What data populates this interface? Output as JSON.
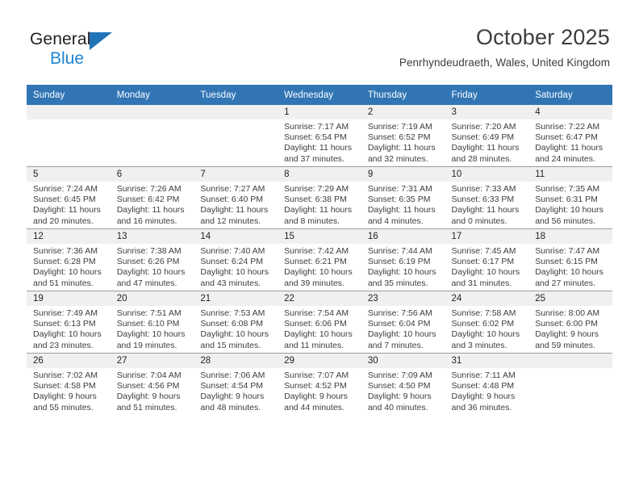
{
  "logo": {
    "text_primary": "General",
    "text_secondary": "Blue",
    "color_primary": "#231f20",
    "color_secondary": "#1f85d0",
    "triangle_color": "#1f73b7"
  },
  "header": {
    "month_title": "October 2025",
    "location": "Penrhyndeudraeth, Wales, United Kingdom"
  },
  "calendar": {
    "header_background": "#3175b5",
    "header_text_color": "#ffffff",
    "daynum_band_background": "#f0f0f0",
    "weekday_headers": [
      "Sunday",
      "Monday",
      "Tuesday",
      "Wednesday",
      "Thursday",
      "Friday",
      "Saturday"
    ],
    "weeks": [
      [
        {
          "day": "",
          "sunrise": "",
          "sunset": "",
          "daylight_line1": "",
          "daylight_line2": "",
          "empty": true
        },
        {
          "day": "",
          "sunrise": "",
          "sunset": "",
          "daylight_line1": "",
          "daylight_line2": "",
          "empty": true
        },
        {
          "day": "",
          "sunrise": "",
          "sunset": "",
          "daylight_line1": "",
          "daylight_line2": "",
          "empty": true
        },
        {
          "day": "1",
          "sunrise": "Sunrise: 7:17 AM",
          "sunset": "Sunset: 6:54 PM",
          "daylight_line1": "Daylight: 11 hours",
          "daylight_line2": "and 37 minutes.",
          "empty": false
        },
        {
          "day": "2",
          "sunrise": "Sunrise: 7:19 AM",
          "sunset": "Sunset: 6:52 PM",
          "daylight_line1": "Daylight: 11 hours",
          "daylight_line2": "and 32 minutes.",
          "empty": false
        },
        {
          "day": "3",
          "sunrise": "Sunrise: 7:20 AM",
          "sunset": "Sunset: 6:49 PM",
          "daylight_line1": "Daylight: 11 hours",
          "daylight_line2": "and 28 minutes.",
          "empty": false
        },
        {
          "day": "4",
          "sunrise": "Sunrise: 7:22 AM",
          "sunset": "Sunset: 6:47 PM",
          "daylight_line1": "Daylight: 11 hours",
          "daylight_line2": "and 24 minutes.",
          "empty": false
        }
      ],
      [
        {
          "day": "5",
          "sunrise": "Sunrise: 7:24 AM",
          "sunset": "Sunset: 6:45 PM",
          "daylight_line1": "Daylight: 11 hours",
          "daylight_line2": "and 20 minutes.",
          "empty": false
        },
        {
          "day": "6",
          "sunrise": "Sunrise: 7:26 AM",
          "sunset": "Sunset: 6:42 PM",
          "daylight_line1": "Daylight: 11 hours",
          "daylight_line2": "and 16 minutes.",
          "empty": false
        },
        {
          "day": "7",
          "sunrise": "Sunrise: 7:27 AM",
          "sunset": "Sunset: 6:40 PM",
          "daylight_line1": "Daylight: 11 hours",
          "daylight_line2": "and 12 minutes.",
          "empty": false
        },
        {
          "day": "8",
          "sunrise": "Sunrise: 7:29 AM",
          "sunset": "Sunset: 6:38 PM",
          "daylight_line1": "Daylight: 11 hours",
          "daylight_line2": "and 8 minutes.",
          "empty": false
        },
        {
          "day": "9",
          "sunrise": "Sunrise: 7:31 AM",
          "sunset": "Sunset: 6:35 PM",
          "daylight_line1": "Daylight: 11 hours",
          "daylight_line2": "and 4 minutes.",
          "empty": false
        },
        {
          "day": "10",
          "sunrise": "Sunrise: 7:33 AM",
          "sunset": "Sunset: 6:33 PM",
          "daylight_line1": "Daylight: 11 hours",
          "daylight_line2": "and 0 minutes.",
          "empty": false
        },
        {
          "day": "11",
          "sunrise": "Sunrise: 7:35 AM",
          "sunset": "Sunset: 6:31 PM",
          "daylight_line1": "Daylight: 10 hours",
          "daylight_line2": "and 56 minutes.",
          "empty": false
        }
      ],
      [
        {
          "day": "12",
          "sunrise": "Sunrise: 7:36 AM",
          "sunset": "Sunset: 6:28 PM",
          "daylight_line1": "Daylight: 10 hours",
          "daylight_line2": "and 51 minutes.",
          "empty": false
        },
        {
          "day": "13",
          "sunrise": "Sunrise: 7:38 AM",
          "sunset": "Sunset: 6:26 PM",
          "daylight_line1": "Daylight: 10 hours",
          "daylight_line2": "and 47 minutes.",
          "empty": false
        },
        {
          "day": "14",
          "sunrise": "Sunrise: 7:40 AM",
          "sunset": "Sunset: 6:24 PM",
          "daylight_line1": "Daylight: 10 hours",
          "daylight_line2": "and 43 minutes.",
          "empty": false
        },
        {
          "day": "15",
          "sunrise": "Sunrise: 7:42 AM",
          "sunset": "Sunset: 6:21 PM",
          "daylight_line1": "Daylight: 10 hours",
          "daylight_line2": "and 39 minutes.",
          "empty": false
        },
        {
          "day": "16",
          "sunrise": "Sunrise: 7:44 AM",
          "sunset": "Sunset: 6:19 PM",
          "daylight_line1": "Daylight: 10 hours",
          "daylight_line2": "and 35 minutes.",
          "empty": false
        },
        {
          "day": "17",
          "sunrise": "Sunrise: 7:45 AM",
          "sunset": "Sunset: 6:17 PM",
          "daylight_line1": "Daylight: 10 hours",
          "daylight_line2": "and 31 minutes.",
          "empty": false
        },
        {
          "day": "18",
          "sunrise": "Sunrise: 7:47 AM",
          "sunset": "Sunset: 6:15 PM",
          "daylight_line1": "Daylight: 10 hours",
          "daylight_line2": "and 27 minutes.",
          "empty": false
        }
      ],
      [
        {
          "day": "19",
          "sunrise": "Sunrise: 7:49 AM",
          "sunset": "Sunset: 6:13 PM",
          "daylight_line1": "Daylight: 10 hours",
          "daylight_line2": "and 23 minutes.",
          "empty": false
        },
        {
          "day": "20",
          "sunrise": "Sunrise: 7:51 AM",
          "sunset": "Sunset: 6:10 PM",
          "daylight_line1": "Daylight: 10 hours",
          "daylight_line2": "and 19 minutes.",
          "empty": false
        },
        {
          "day": "21",
          "sunrise": "Sunrise: 7:53 AM",
          "sunset": "Sunset: 6:08 PM",
          "daylight_line1": "Daylight: 10 hours",
          "daylight_line2": "and 15 minutes.",
          "empty": false
        },
        {
          "day": "22",
          "sunrise": "Sunrise: 7:54 AM",
          "sunset": "Sunset: 6:06 PM",
          "daylight_line1": "Daylight: 10 hours",
          "daylight_line2": "and 11 minutes.",
          "empty": false
        },
        {
          "day": "23",
          "sunrise": "Sunrise: 7:56 AM",
          "sunset": "Sunset: 6:04 PM",
          "daylight_line1": "Daylight: 10 hours",
          "daylight_line2": "and 7 minutes.",
          "empty": false
        },
        {
          "day": "24",
          "sunrise": "Sunrise: 7:58 AM",
          "sunset": "Sunset: 6:02 PM",
          "daylight_line1": "Daylight: 10 hours",
          "daylight_line2": "and 3 minutes.",
          "empty": false
        },
        {
          "day": "25",
          "sunrise": "Sunrise: 8:00 AM",
          "sunset": "Sunset: 6:00 PM",
          "daylight_line1": "Daylight: 9 hours",
          "daylight_line2": "and 59 minutes.",
          "empty": false
        }
      ],
      [
        {
          "day": "26",
          "sunrise": "Sunrise: 7:02 AM",
          "sunset": "Sunset: 4:58 PM",
          "daylight_line1": "Daylight: 9 hours",
          "daylight_line2": "and 55 minutes.",
          "empty": false
        },
        {
          "day": "27",
          "sunrise": "Sunrise: 7:04 AM",
          "sunset": "Sunset: 4:56 PM",
          "daylight_line1": "Daylight: 9 hours",
          "daylight_line2": "and 51 minutes.",
          "empty": false
        },
        {
          "day": "28",
          "sunrise": "Sunrise: 7:06 AM",
          "sunset": "Sunset: 4:54 PM",
          "daylight_line1": "Daylight: 9 hours",
          "daylight_line2": "and 48 minutes.",
          "empty": false
        },
        {
          "day": "29",
          "sunrise": "Sunrise: 7:07 AM",
          "sunset": "Sunset: 4:52 PM",
          "daylight_line1": "Daylight: 9 hours",
          "daylight_line2": "and 44 minutes.",
          "empty": false
        },
        {
          "day": "30",
          "sunrise": "Sunrise: 7:09 AM",
          "sunset": "Sunset: 4:50 PM",
          "daylight_line1": "Daylight: 9 hours",
          "daylight_line2": "and 40 minutes.",
          "empty": false
        },
        {
          "day": "31",
          "sunrise": "Sunrise: 7:11 AM",
          "sunset": "Sunset: 4:48 PM",
          "daylight_line1": "Daylight: 9 hours",
          "daylight_line2": "and 36 minutes.",
          "empty": false
        },
        {
          "day": "",
          "sunrise": "",
          "sunset": "",
          "daylight_line1": "",
          "daylight_line2": "",
          "empty": true
        }
      ]
    ]
  }
}
